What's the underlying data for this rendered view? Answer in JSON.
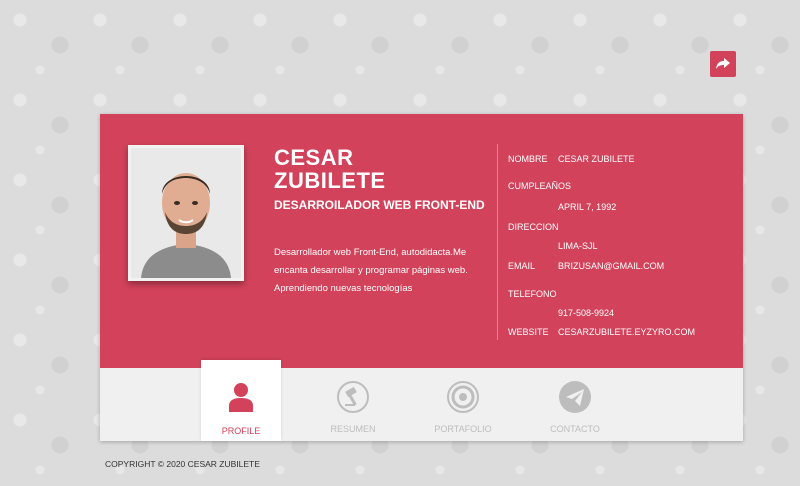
{
  "share": {
    "icon": "share-arrow-icon"
  },
  "profile": {
    "first_name": "CESAR",
    "last_name": "ZUBILETE",
    "role": "DESARROILADOR WEB FRONT-END",
    "bio": "Desarrollador web Front-End, autodidacta.Me encanta desarrollar y programar páginas web. Aprendiendo nuevas tecnologías"
  },
  "info": {
    "nombre_label": "NOMBRE",
    "nombre_value": "CESAR ZUBILETE",
    "cumple_label": "CUMPLEAÑOS",
    "cumple_value": "APRIL 7, 1992",
    "direccion_label": "DIRECCION",
    "direccion_value": "LIMA-SJL",
    "email_label": "EMAIL",
    "email_value": "BRIZUSAN@GMAIL.COM",
    "telefono_label": "TELEFONO",
    "telefono_value": "917-508-9924",
    "website_label": "WEBSITE",
    "website_value": "CESARZUBILETE.EYZYRO.COM"
  },
  "tabs": [
    {
      "label": "PROFILE",
      "icon": "user-icon",
      "active": true
    },
    {
      "label": "RESUMEN",
      "icon": "gavel-icon",
      "active": false
    },
    {
      "label": "PORTAFOLIO",
      "icon": "portfolio-icon",
      "active": false
    },
    {
      "label": "CONTACTO",
      "icon": "paper-plane-icon",
      "active": false
    }
  ],
  "footer": {
    "copyright": "COPYRIGHT © 2020 CESAR ZUBILETE"
  },
  "colors": {
    "accent": "#d2425b",
    "tab_bg": "#f0f0f0",
    "inactive": "#bdbdbd"
  }
}
